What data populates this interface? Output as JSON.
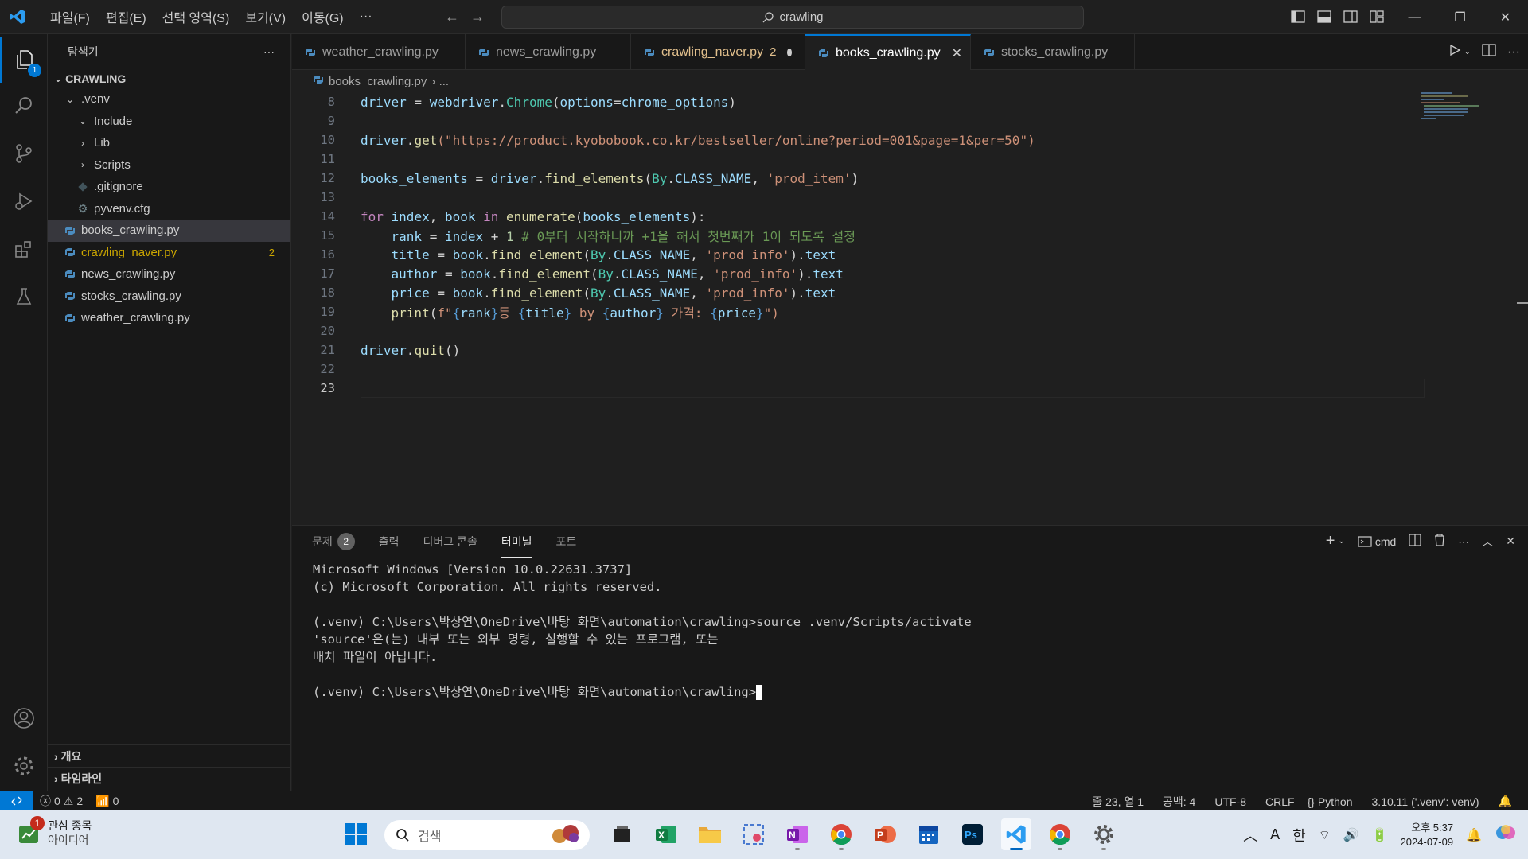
{
  "titlebar": {
    "menu": [
      "파일(F)",
      "편집(E)",
      "선택 영역(S)",
      "보기(V)",
      "이동(G)",
      "···"
    ],
    "search": "crawling"
  },
  "activitybar": {
    "explorer_badge": "1"
  },
  "sidebar": {
    "title": "탐색기",
    "more": "···",
    "section": "CRAWLING",
    "items": [
      {
        "label": ".venv",
        "type": "folder-open",
        "level": 1
      },
      {
        "label": "Include",
        "type": "folder-open",
        "level": 2
      },
      {
        "label": "Lib",
        "type": "folder",
        "level": 2
      },
      {
        "label": "Scripts",
        "type": "folder",
        "level": 2
      },
      {
        "label": ".gitignore",
        "type": "git",
        "level": 2
      },
      {
        "label": "pyvenv.cfg",
        "type": "cfg",
        "level": 2
      },
      {
        "label": "books_crawling.py",
        "type": "py",
        "level": 1
      },
      {
        "label": "crawling_naver.py",
        "type": "py",
        "level": 1,
        "count": "2"
      },
      {
        "label": "news_crawling.py",
        "type": "py",
        "level": 1
      },
      {
        "label": "stocks_crawling.py",
        "type": "py",
        "level": 1
      },
      {
        "label": "weather_crawling.py",
        "type": "py",
        "level": 1
      }
    ],
    "outline": "개요",
    "timeline": "타임라인"
  },
  "tabs": [
    {
      "label": "weather_crawling.py"
    },
    {
      "label": "news_crawling.py"
    },
    {
      "label": "crawling_naver.py",
      "count": "2"
    },
    {
      "label": "books_crawling.py"
    },
    {
      "label": "stocks_crawling.py"
    }
  ],
  "breadcrumb": {
    "file": "books_crawling.py",
    "sep": "› ..."
  },
  "code_lines": [
    "8",
    "9",
    "10",
    "11",
    "12",
    "13",
    "14",
    "15",
    "16",
    "17",
    "18",
    "19",
    "20",
    "21",
    "22",
    "23"
  ],
  "code": {
    "l8_a": "driver",
    "l8_b": " = ",
    "l8_c": "webdriver",
    "l8_d": ".",
    "l8_e": "Chrome",
    "l8_f": "(",
    "l8_g": "options",
    "l8_h": "=",
    "l8_i": "chrome_options",
    "l8_j": ")",
    "l10_a": "driver",
    "l10_b": ".",
    "l10_c": "get",
    "l10_d": "(\"",
    "l10_url": "https://product.kyobobook.co.kr/bestseller/online?period=001&page=1&per=50",
    "l10_e": "\")",
    "l12_a": "books_elements",
    "l12_b": " = ",
    "l12_c": "driver",
    "l12_d": ".",
    "l12_e": "find_elements",
    "l12_f": "(",
    "l12_g": "By",
    "l12_h": ".",
    "l12_i": "CLASS_NAME",
    "l12_j": ", ",
    "l12_k": "'prod_item'",
    "l12_l": ")",
    "l14_a": "for",
    "l14_b": " index",
    "l14_c": ", ",
    "l14_d": "book",
    "l14_e": " in ",
    "l14_f": "enumerate",
    "l14_g": "(",
    "l14_h": "books_elements",
    "l14_i": "):",
    "l15_a": "    rank",
    "l15_b": " = ",
    "l15_c": "index",
    "l15_d": " + ",
    "l15_e": "1",
    "l15_f": " # 0부터 시작하니까 +1을 해서 첫번째가 1이 되도록 설정",
    "l16_a": "    title",
    "l16_b": " = ",
    "l16_c": "book",
    "l16_d": ".",
    "l16_e": "find_element",
    "l16_f": "(",
    "l16_g": "By",
    "l16_h": ".",
    "l16_i": "CLASS_NAME",
    "l16_j": ", ",
    "l16_k": "'prod_info'",
    "l16_l": ").",
    "l16_m": "text",
    "l17_a": "    author",
    "l17_k": "'prod_info'",
    "l18_a": "    price",
    "l18_k": "'prod_info'",
    "l19_a": "    ",
    "l19_b": "print",
    "l19_c": "(",
    "l19_d": "f\"",
    "l19_e": "{",
    "l19_f": "rank",
    "l19_g": "}",
    "l19_h": "등 ",
    "l19_i": "title",
    "l19_j": " by ",
    "l19_k": "author",
    "l19_l": " 가격: ",
    "l19_m": "price",
    "l19_n": "\")",
    "l21_a": "driver",
    "l21_b": ".",
    "l21_c": "quit",
    "l21_d": "()"
  },
  "panel": {
    "tabs": [
      {
        "label": "문제",
        "badge": "2"
      },
      {
        "label": "출력"
      },
      {
        "label": "디버그 콘솔"
      },
      {
        "label": "터미널"
      },
      {
        "label": "포트"
      }
    ],
    "shell": "cmd",
    "terminal": "Microsoft Windows [Version 10.0.22631.3737]\n(c) Microsoft Corporation. All rights reserved.\n\n(.venv) C:\\Users\\박상연\\OneDrive\\바탕 화면\\automation\\crawling>source .venv/Scripts/activate\n'source'은(는) 내부 또는 외부 명령, 실행할 수 있는 프로그램, 또는\n배치 파일이 아닙니다.\n\n(.venv) C:\\Users\\박상연\\OneDrive\\바탕 화면\\automation\\crawling>"
  },
  "statusbar": {
    "errors": "0",
    "warnings": "2",
    "ports": "0",
    "position": "줄 23, 열 1",
    "spaces": "공백: 4",
    "encoding": "UTF-8",
    "eol": "CRLF",
    "language": "Python",
    "interpreter": "3.10.11 ('.venv': venv)"
  },
  "taskbar": {
    "widget_title": "관심 종목",
    "widget_sub": "아이디어",
    "widget_badge": "1",
    "search": "검색",
    "ime_a": "A",
    "ime_lang": "한",
    "time": "오후 5:37",
    "date": "2024-07-09"
  },
  "colors": {
    "accent": "#0078d4",
    "warning": "#cca700"
  }
}
